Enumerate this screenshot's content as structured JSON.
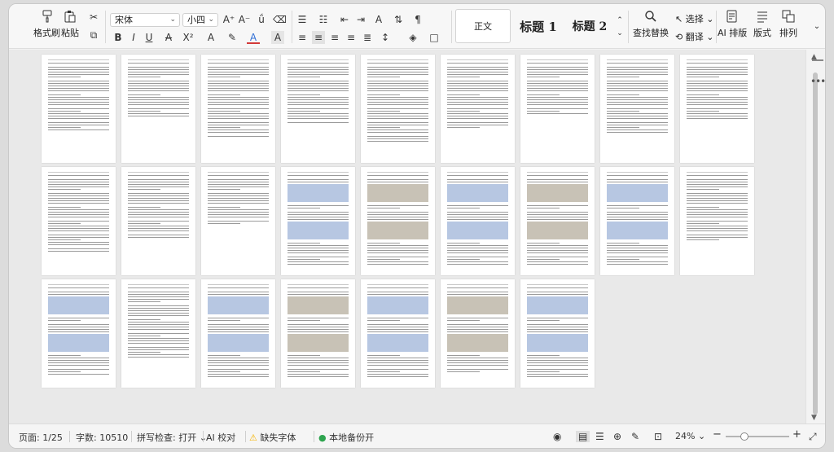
{
  "ribbon": {
    "format_painter": "格式刷",
    "paste": "粘贴",
    "font_name": "宋体",
    "font_size": "小四",
    "style_normal": "正文",
    "style_h1": "标题 1",
    "style_h2": "标题 2",
    "find_replace": "查找替换",
    "select": "选择",
    "translate": "翻译",
    "ai_layout": "AI 排版",
    "layout": "版式",
    "arrange": "排列"
  },
  "status": {
    "page": "页面: 1/25",
    "word_count": "字数: 10510",
    "spell_check": "拼写检查: 打开",
    "ai_proof": "AI 校对",
    "missing_fonts": "缺失字体",
    "local_backup": "本地备份开",
    "zoom": "24%"
  },
  "colors": {
    "accent_red": "#d23a3a",
    "accent_blue": "#2f6fd6",
    "backup_green": "#2ea44f",
    "warn_yellow": "#f5b301"
  }
}
